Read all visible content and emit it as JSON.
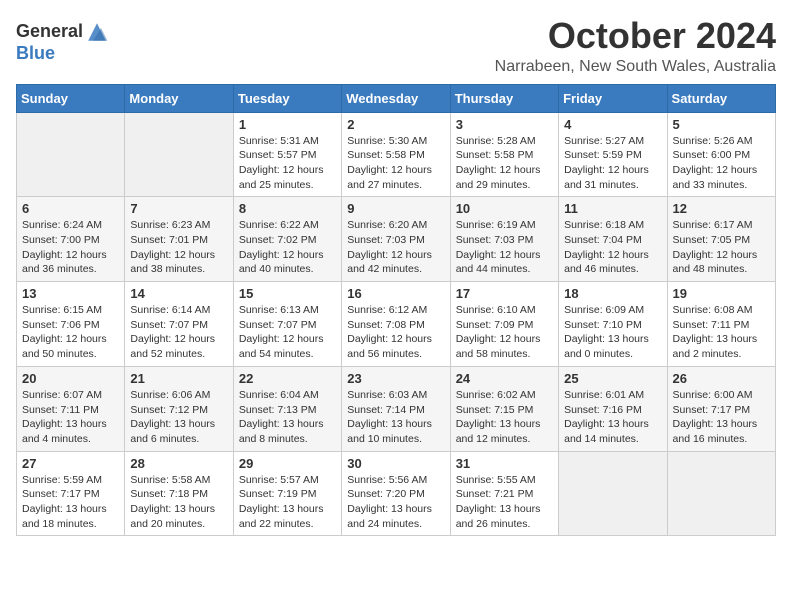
{
  "logo": {
    "line1": "General",
    "line2": "Blue"
  },
  "title": "October 2024",
  "location": "Narrabeen, New South Wales, Australia",
  "weekdays": [
    "Sunday",
    "Monday",
    "Tuesday",
    "Wednesday",
    "Thursday",
    "Friday",
    "Saturday"
  ],
  "weeks": [
    [
      {
        "day": "",
        "empty": true
      },
      {
        "day": "",
        "empty": true
      },
      {
        "day": "1",
        "sunrise": "Sunrise: 5:31 AM",
        "sunset": "Sunset: 5:57 PM",
        "daylight": "Daylight: 12 hours and 25 minutes."
      },
      {
        "day": "2",
        "sunrise": "Sunrise: 5:30 AM",
        "sunset": "Sunset: 5:58 PM",
        "daylight": "Daylight: 12 hours and 27 minutes."
      },
      {
        "day": "3",
        "sunrise": "Sunrise: 5:28 AM",
        "sunset": "Sunset: 5:58 PM",
        "daylight": "Daylight: 12 hours and 29 minutes."
      },
      {
        "day": "4",
        "sunrise": "Sunrise: 5:27 AM",
        "sunset": "Sunset: 5:59 PM",
        "daylight": "Daylight: 12 hours and 31 minutes."
      },
      {
        "day": "5",
        "sunrise": "Sunrise: 5:26 AM",
        "sunset": "Sunset: 6:00 PM",
        "daylight": "Daylight: 12 hours and 33 minutes."
      }
    ],
    [
      {
        "day": "6",
        "sunrise": "Sunrise: 6:24 AM",
        "sunset": "Sunset: 7:00 PM",
        "daylight": "Daylight: 12 hours and 36 minutes."
      },
      {
        "day": "7",
        "sunrise": "Sunrise: 6:23 AM",
        "sunset": "Sunset: 7:01 PM",
        "daylight": "Daylight: 12 hours and 38 minutes."
      },
      {
        "day": "8",
        "sunrise": "Sunrise: 6:22 AM",
        "sunset": "Sunset: 7:02 PM",
        "daylight": "Daylight: 12 hours and 40 minutes."
      },
      {
        "day": "9",
        "sunrise": "Sunrise: 6:20 AM",
        "sunset": "Sunset: 7:03 PM",
        "daylight": "Daylight: 12 hours and 42 minutes."
      },
      {
        "day": "10",
        "sunrise": "Sunrise: 6:19 AM",
        "sunset": "Sunset: 7:03 PM",
        "daylight": "Daylight: 12 hours and 44 minutes."
      },
      {
        "day": "11",
        "sunrise": "Sunrise: 6:18 AM",
        "sunset": "Sunset: 7:04 PM",
        "daylight": "Daylight: 12 hours and 46 minutes."
      },
      {
        "day": "12",
        "sunrise": "Sunrise: 6:17 AM",
        "sunset": "Sunset: 7:05 PM",
        "daylight": "Daylight: 12 hours and 48 minutes."
      }
    ],
    [
      {
        "day": "13",
        "sunrise": "Sunrise: 6:15 AM",
        "sunset": "Sunset: 7:06 PM",
        "daylight": "Daylight: 12 hours and 50 minutes."
      },
      {
        "day": "14",
        "sunrise": "Sunrise: 6:14 AM",
        "sunset": "Sunset: 7:07 PM",
        "daylight": "Daylight: 12 hours and 52 minutes."
      },
      {
        "day": "15",
        "sunrise": "Sunrise: 6:13 AM",
        "sunset": "Sunset: 7:07 PM",
        "daylight": "Daylight: 12 hours and 54 minutes."
      },
      {
        "day": "16",
        "sunrise": "Sunrise: 6:12 AM",
        "sunset": "Sunset: 7:08 PM",
        "daylight": "Daylight: 12 hours and 56 minutes."
      },
      {
        "day": "17",
        "sunrise": "Sunrise: 6:10 AM",
        "sunset": "Sunset: 7:09 PM",
        "daylight": "Daylight: 12 hours and 58 minutes."
      },
      {
        "day": "18",
        "sunrise": "Sunrise: 6:09 AM",
        "sunset": "Sunset: 7:10 PM",
        "daylight": "Daylight: 13 hours and 0 minutes."
      },
      {
        "day": "19",
        "sunrise": "Sunrise: 6:08 AM",
        "sunset": "Sunset: 7:11 PM",
        "daylight": "Daylight: 13 hours and 2 minutes."
      }
    ],
    [
      {
        "day": "20",
        "sunrise": "Sunrise: 6:07 AM",
        "sunset": "Sunset: 7:11 PM",
        "daylight": "Daylight: 13 hours and 4 minutes."
      },
      {
        "day": "21",
        "sunrise": "Sunrise: 6:06 AM",
        "sunset": "Sunset: 7:12 PM",
        "daylight": "Daylight: 13 hours and 6 minutes."
      },
      {
        "day": "22",
        "sunrise": "Sunrise: 6:04 AM",
        "sunset": "Sunset: 7:13 PM",
        "daylight": "Daylight: 13 hours and 8 minutes."
      },
      {
        "day": "23",
        "sunrise": "Sunrise: 6:03 AM",
        "sunset": "Sunset: 7:14 PM",
        "daylight": "Daylight: 13 hours and 10 minutes."
      },
      {
        "day": "24",
        "sunrise": "Sunrise: 6:02 AM",
        "sunset": "Sunset: 7:15 PM",
        "daylight": "Daylight: 13 hours and 12 minutes."
      },
      {
        "day": "25",
        "sunrise": "Sunrise: 6:01 AM",
        "sunset": "Sunset: 7:16 PM",
        "daylight": "Daylight: 13 hours and 14 minutes."
      },
      {
        "day": "26",
        "sunrise": "Sunrise: 6:00 AM",
        "sunset": "Sunset: 7:17 PM",
        "daylight": "Daylight: 13 hours and 16 minutes."
      }
    ],
    [
      {
        "day": "27",
        "sunrise": "Sunrise: 5:59 AM",
        "sunset": "Sunset: 7:17 PM",
        "daylight": "Daylight: 13 hours and 18 minutes."
      },
      {
        "day": "28",
        "sunrise": "Sunrise: 5:58 AM",
        "sunset": "Sunset: 7:18 PM",
        "daylight": "Daylight: 13 hours and 20 minutes."
      },
      {
        "day": "29",
        "sunrise": "Sunrise: 5:57 AM",
        "sunset": "Sunset: 7:19 PM",
        "daylight": "Daylight: 13 hours and 22 minutes."
      },
      {
        "day": "30",
        "sunrise": "Sunrise: 5:56 AM",
        "sunset": "Sunset: 7:20 PM",
        "daylight": "Daylight: 13 hours and 24 minutes."
      },
      {
        "day": "31",
        "sunrise": "Sunrise: 5:55 AM",
        "sunset": "Sunset: 7:21 PM",
        "daylight": "Daylight: 13 hours and 26 minutes."
      },
      {
        "day": "",
        "empty": true
      },
      {
        "day": "",
        "empty": true
      }
    ]
  ]
}
